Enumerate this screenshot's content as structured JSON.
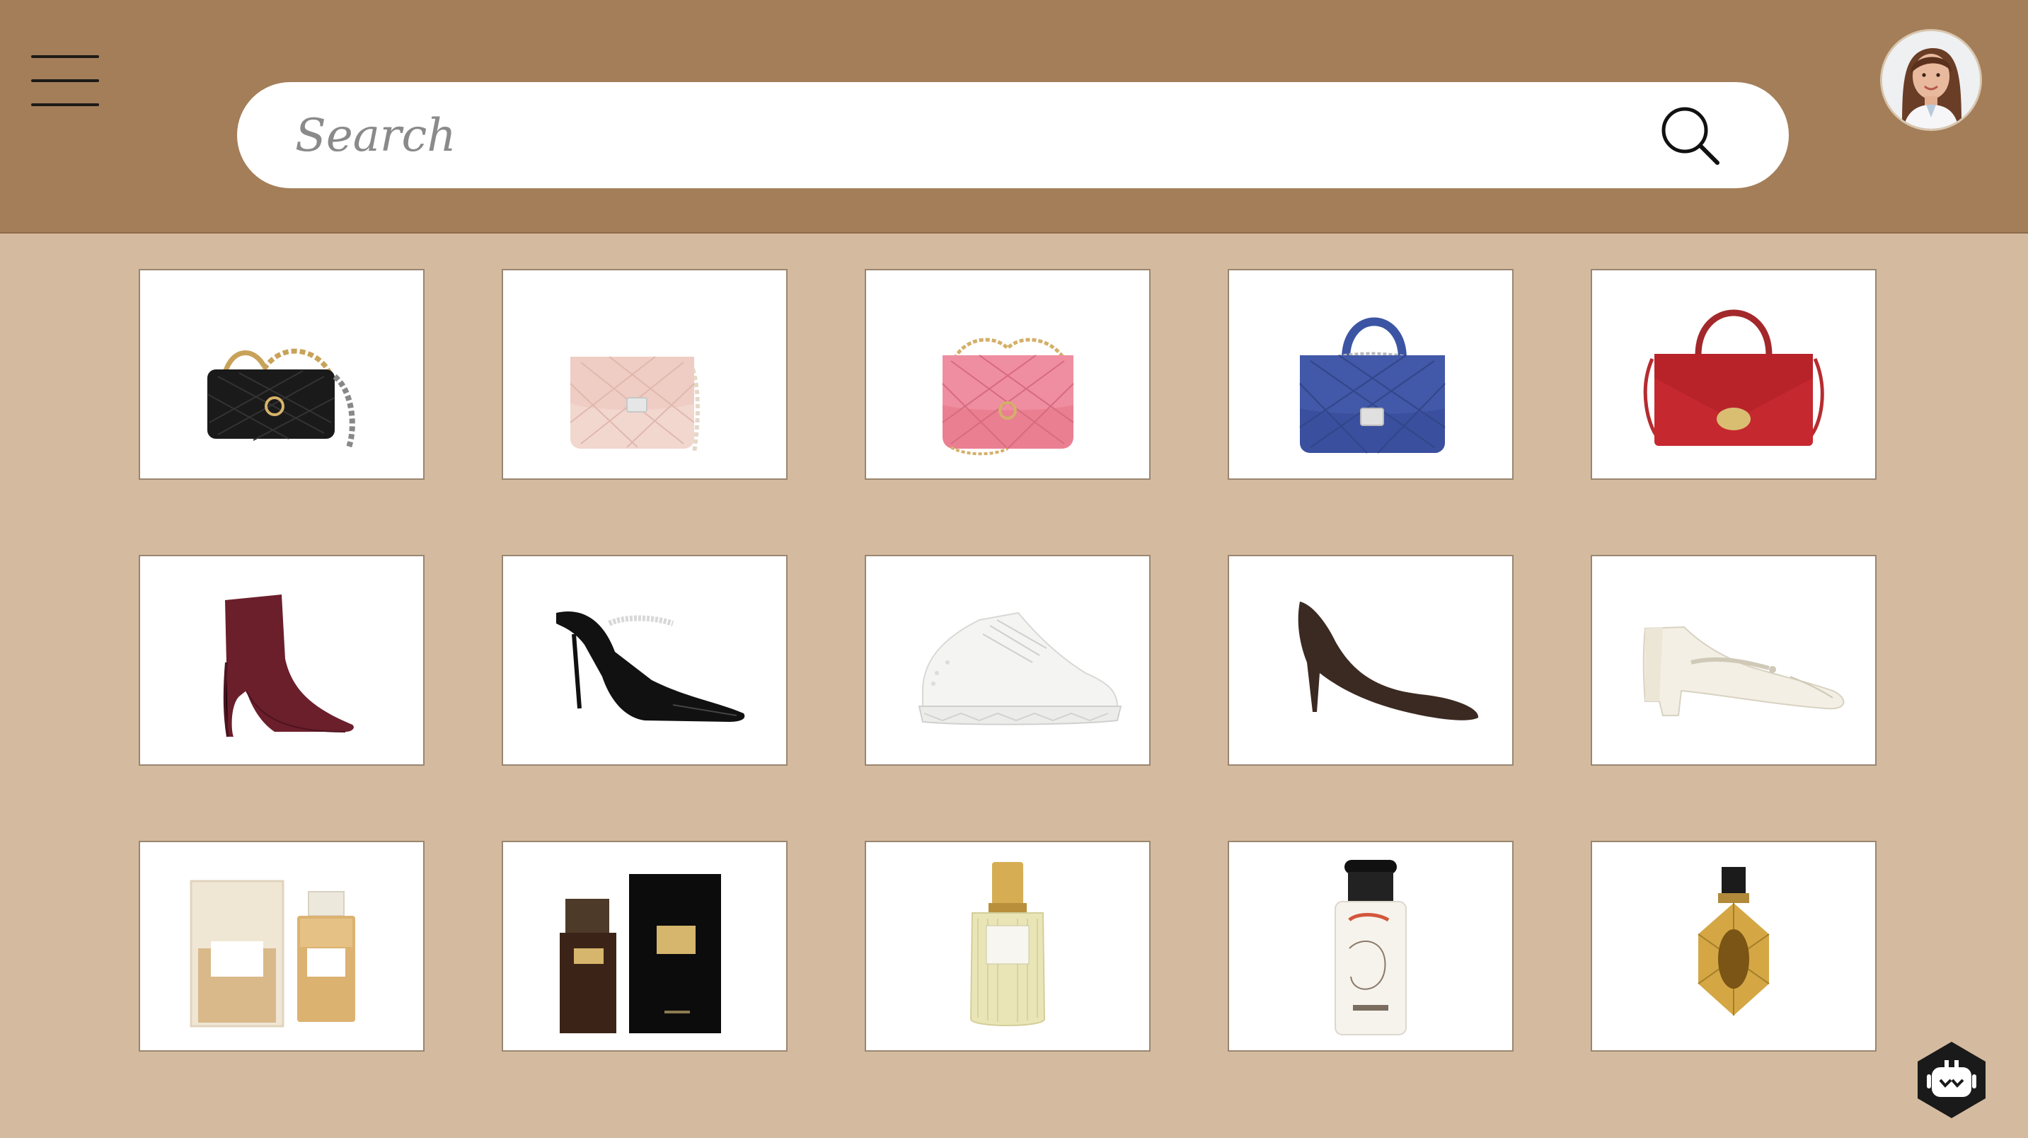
{
  "header": {
    "menu_icon": "hamburger-menu-icon",
    "search": {
      "placeholder": "Search",
      "value": "",
      "icon": "search-icon"
    },
    "avatar": "user-avatar"
  },
  "products": [
    {
      "icon": "black-quilted-chain-bag"
    },
    {
      "icon": "pink-quilted-flap-bag"
    },
    {
      "icon": "hot-pink-quilted-mini-bag"
    },
    {
      "icon": "blue-quilted-top-handle-bag"
    },
    {
      "icon": "red-top-handle-bag"
    },
    {
      "icon": "burgundy-ankle-boot"
    },
    {
      "icon": "black-embellished-mule"
    },
    {
      "icon": "white-sneaker"
    },
    {
      "icon": "brown-suede-pump"
    },
    {
      "icon": "cream-mary-jane-pump"
    },
    {
      "icon": "chanel-no5-perfume-set"
    },
    {
      "icon": "dolce-gabbana-velvet-perfume"
    },
    {
      "icon": "estee-lauder-perfume"
    },
    {
      "icon": "hermes-perfume"
    },
    {
      "icon": "gold-faceted-perfume"
    }
  ],
  "assistant_icon": "chatbot-icon",
  "colors": {
    "header": "#a37e59",
    "background": "#d4bb9f",
    "tile": "#ffffff"
  }
}
